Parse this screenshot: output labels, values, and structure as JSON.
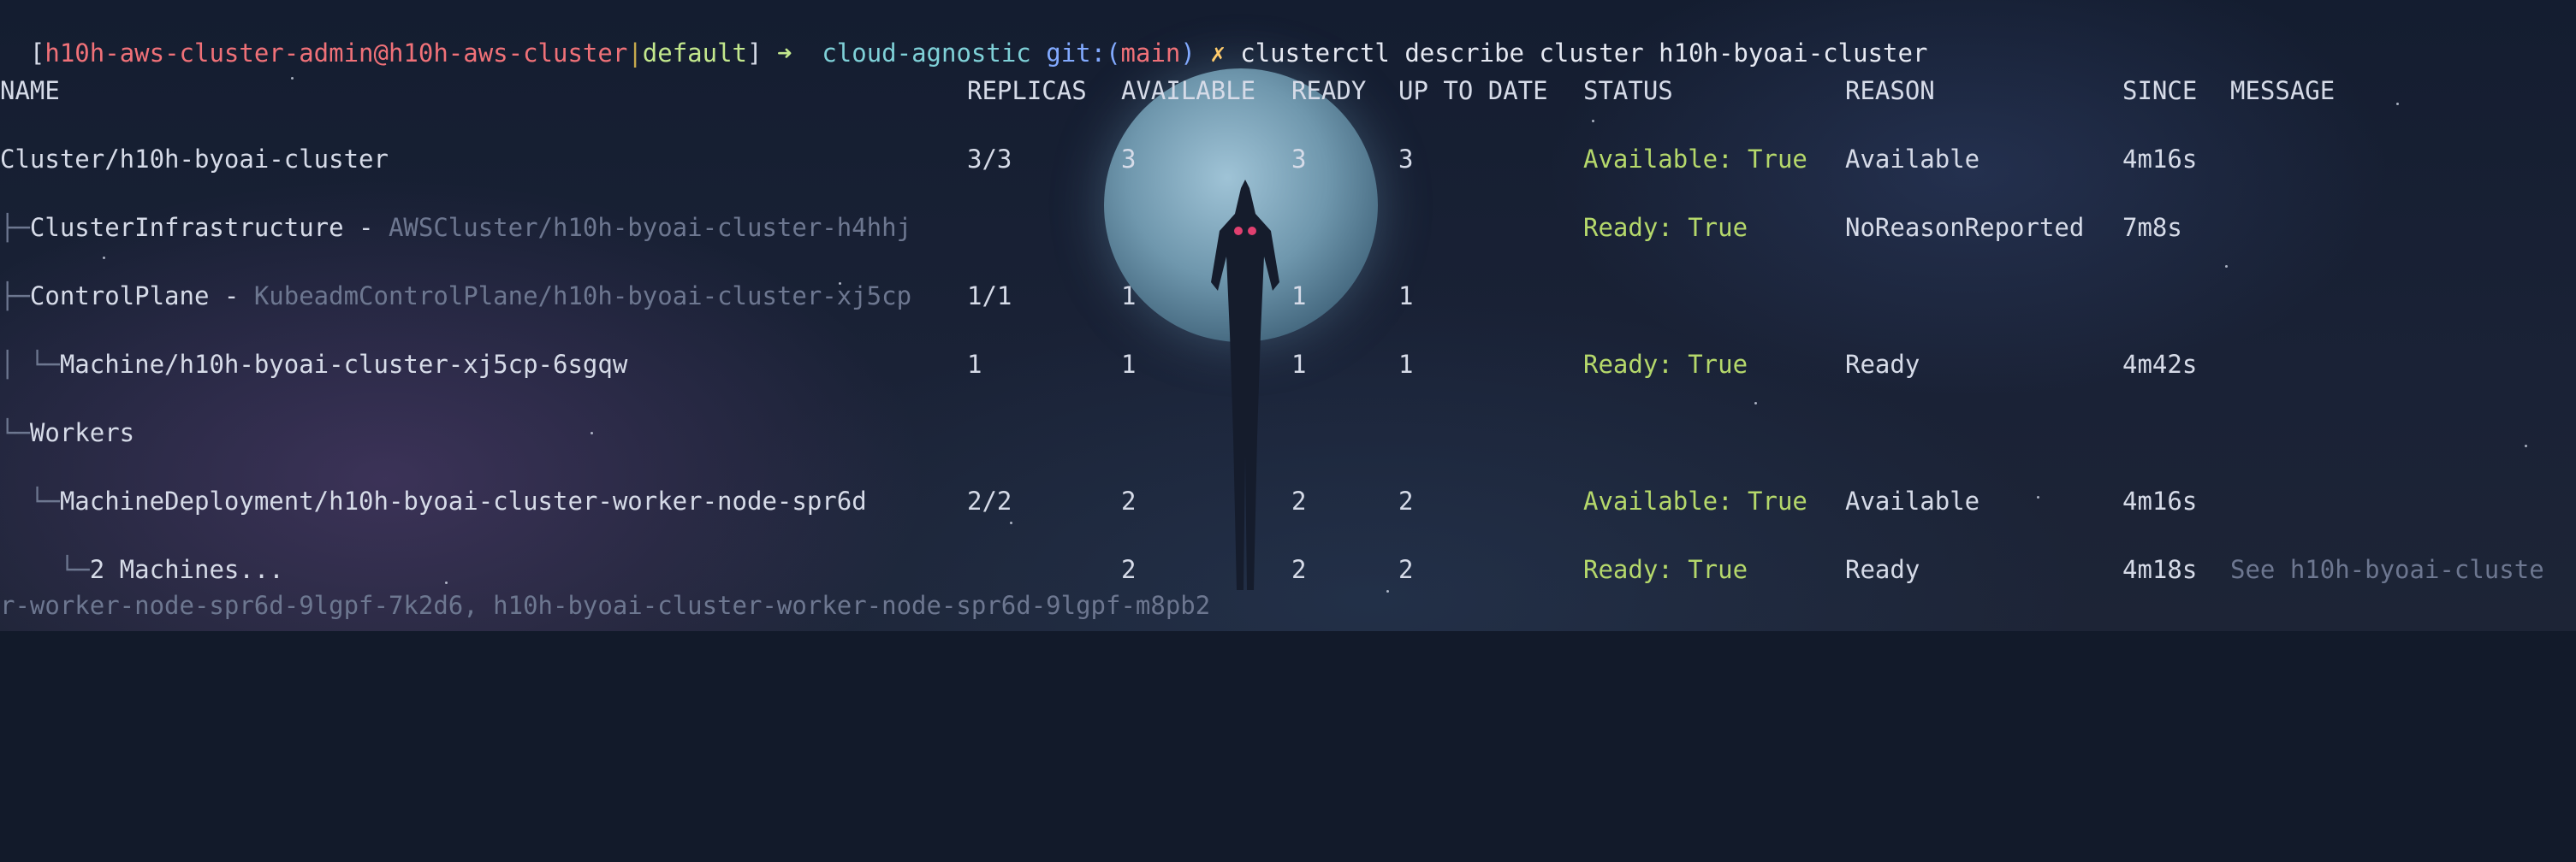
{
  "prompt": {
    "bracket_open": "[",
    "user_host": "h10h-aws-cluster-admin@h10h-aws-cluster",
    "pipe": "|",
    "context": "default",
    "bracket_close": "]",
    "arrow": "➜",
    "dir": "cloud-agnostic",
    "git_label": "git:(",
    "branch": "main",
    "git_close": ")",
    "dirty": "✗",
    "command": "clusterctl describe cluster h10h-byoai-cluster"
  },
  "headers": {
    "name": "NAME",
    "replicas": "REPLICAS",
    "available": "AVAILABLE",
    "ready": "READY",
    "uptodate": "UP TO DATE",
    "status": "STATUS",
    "reason": "REASON",
    "since": "SINCE",
    "message": "MESSAGE"
  },
  "rows": [
    {
      "tree": "",
      "name": "Cluster/h10h-byoai-cluster",
      "ref": "",
      "replicas": "3/3",
      "available": "3",
      "ready": "3",
      "uptodate": "3",
      "status": "Available: True",
      "reason": "Available",
      "since": "4m16s",
      "message": ""
    },
    {
      "tree": "├─",
      "name": "ClusterInfrastructure - ",
      "ref": "AWSCluster/h10h-byoai-cluster-h4hhj",
      "replicas": "",
      "available": "",
      "ready": "",
      "uptodate": "",
      "status": "Ready: True",
      "reason": "NoReasonReported",
      "since": "7m8s",
      "message": ""
    },
    {
      "tree": "├─",
      "name": "ControlPlane - ",
      "ref": "KubeadmControlPlane/h10h-byoai-cluster-xj5cp",
      "replicas": "1/1",
      "available": "1",
      "ready": "1",
      "uptodate": "1",
      "status": "",
      "reason": "",
      "since": "",
      "message": ""
    },
    {
      "tree": "│ └─",
      "name": "Machine/h10h-byoai-cluster-xj5cp-6sgqw",
      "ref": "",
      "replicas": "1",
      "available": "1",
      "ready": "1",
      "uptodate": "1",
      "status": "Ready: True",
      "reason": "Ready",
      "since": "4m42s",
      "message": ""
    },
    {
      "tree": "└─",
      "name": "Workers",
      "ref": "",
      "replicas": "",
      "available": "",
      "ready": "",
      "uptodate": "",
      "status": "",
      "reason": "",
      "since": "",
      "message": ""
    },
    {
      "tree": "  └─",
      "name": "MachineDeployment/h10h-byoai-cluster-worker-node-spr6d",
      "ref": "",
      "replicas": "2/2",
      "available": "2",
      "ready": "2",
      "uptodate": "2",
      "status": "Available: True",
      "reason": "Available",
      "since": "4m16s",
      "message": ""
    },
    {
      "tree": "    └─",
      "name": "2 Machines...",
      "ref": "",
      "replicas": "",
      "available": "2",
      "ready": "2",
      "uptodate": "2",
      "status": "Ready: True",
      "reason": "Ready",
      "since": "4m18s",
      "message": "See h10h-byoai-cluste"
    }
  ],
  "wrap_line": "r-worker-node-spr6d-9lgpf-7k2d6, h10h-byoai-cluster-worker-node-spr6d-9lgpf-m8pb2",
  "colors": {
    "background": "#121a2a",
    "text": "#d6dbe8",
    "status_green": "#b5d86b",
    "user_red": "#f07178",
    "dir_cyan": "#7fd1d8",
    "git_blue": "#82aaff",
    "dim": "#6d7790"
  }
}
